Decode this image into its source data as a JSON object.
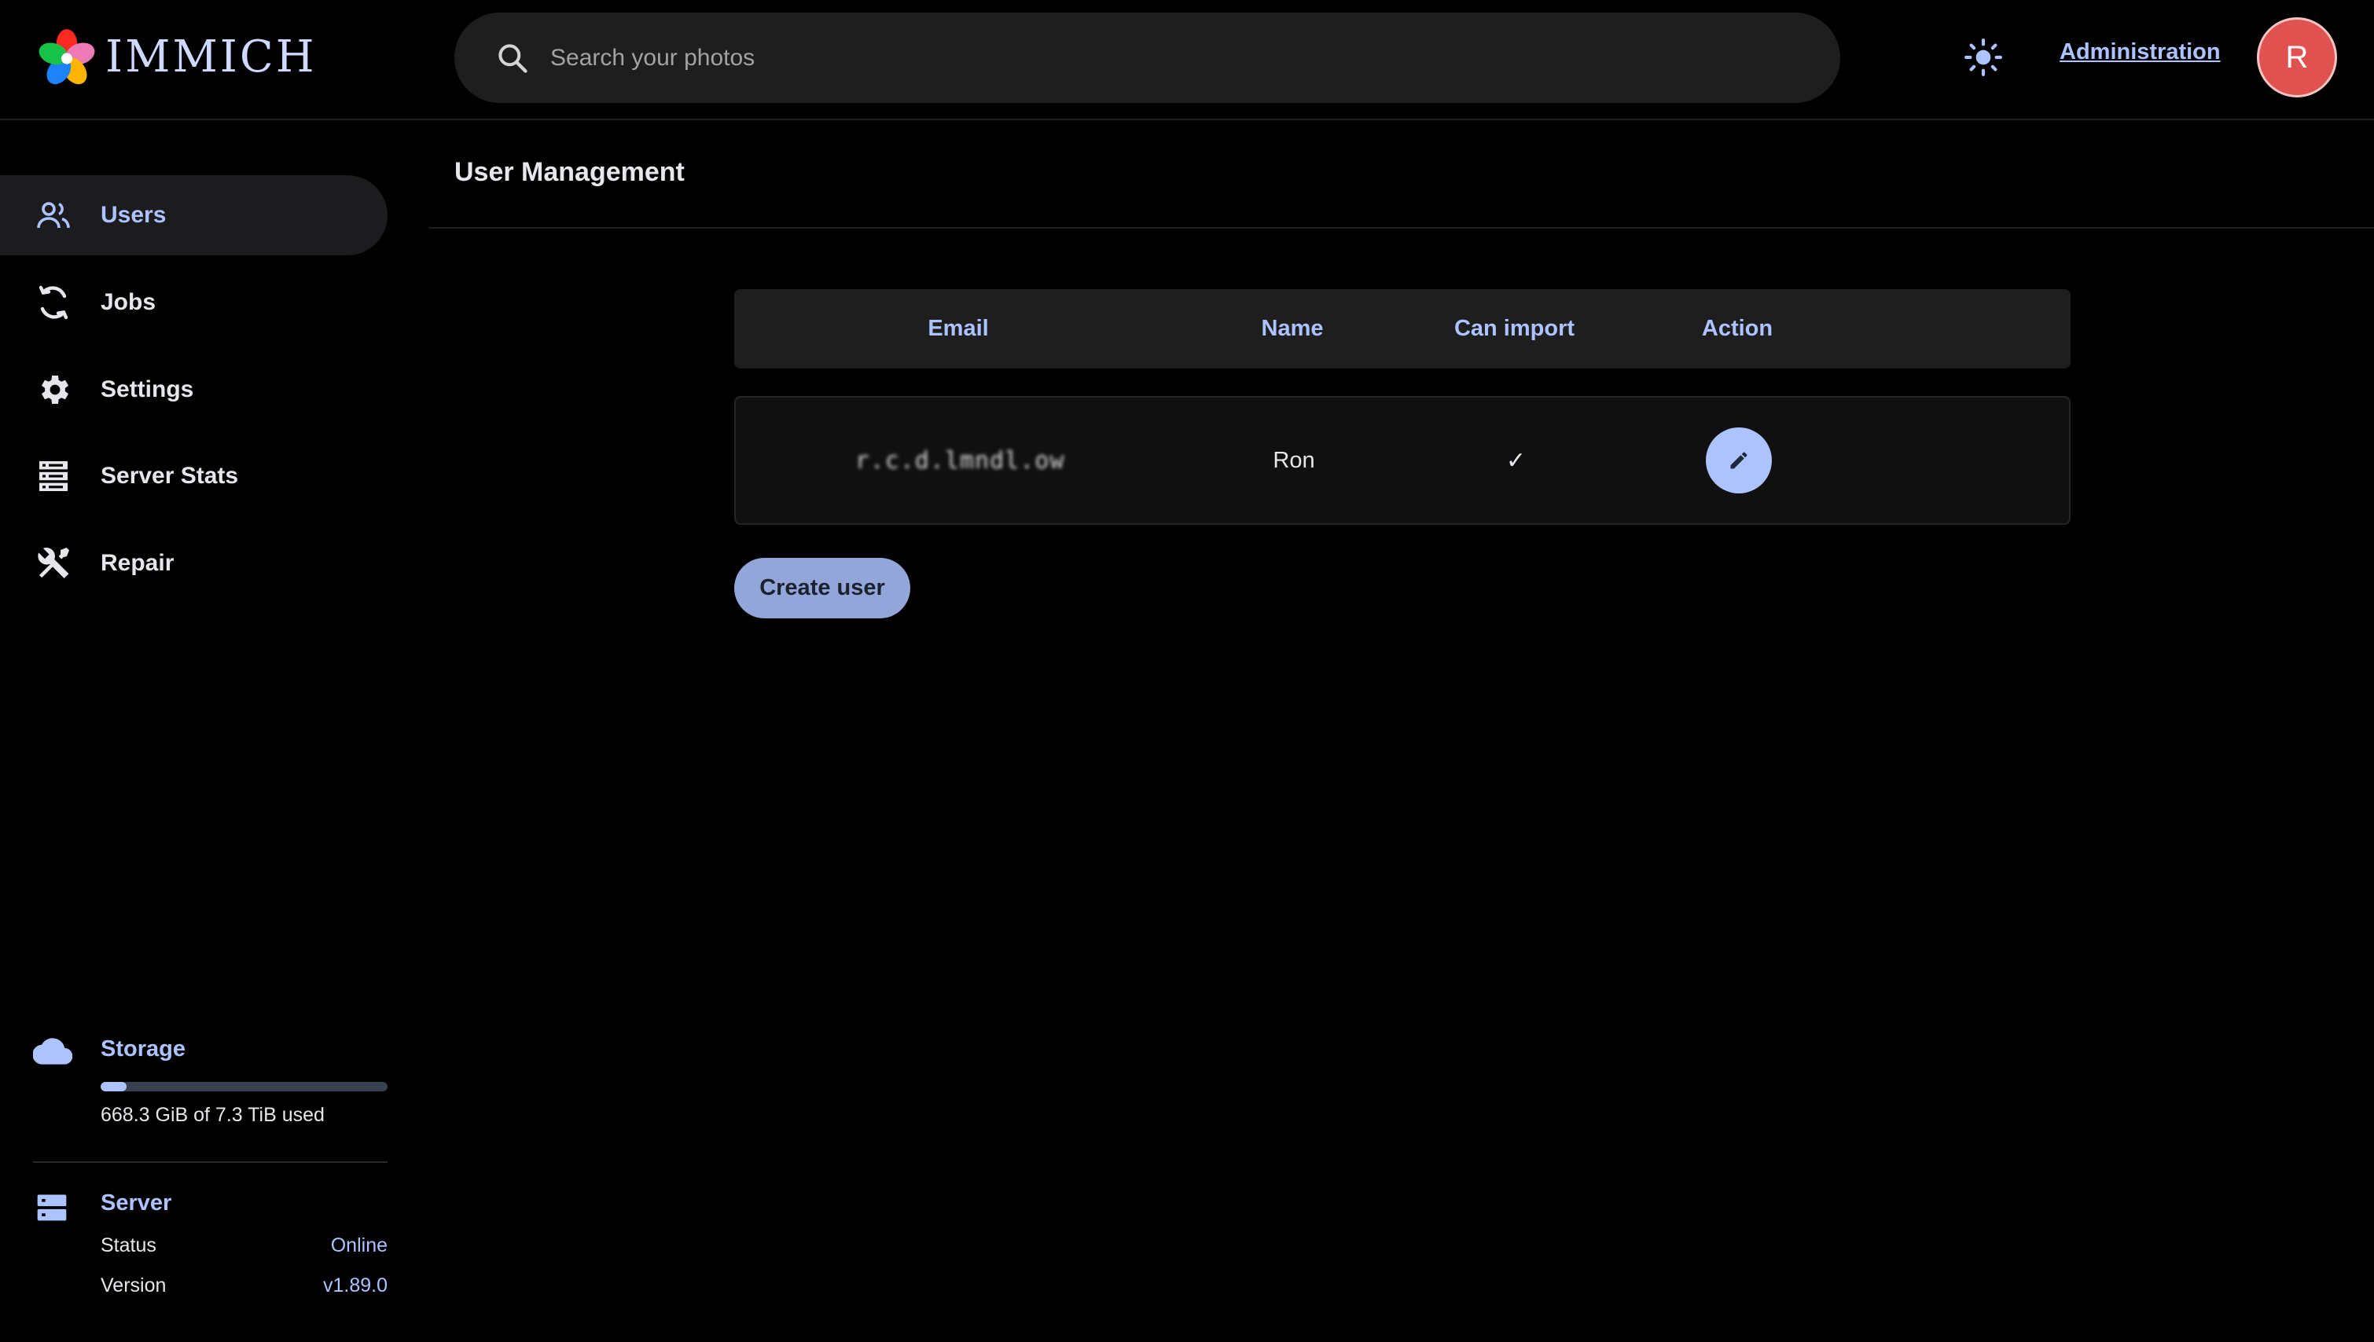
{
  "header": {
    "app_name": "IMMICH",
    "search_placeholder": "Search your photos",
    "admin_link": "Administration",
    "avatar_initial": "R"
  },
  "sidebar": {
    "items": [
      {
        "label": "Users",
        "icon": "users-icon",
        "active": true
      },
      {
        "label": "Jobs",
        "icon": "sync-icon",
        "active": false
      },
      {
        "label": "Settings",
        "icon": "gear-icon",
        "active": false
      },
      {
        "label": "Server Stats",
        "icon": "server-stats-icon",
        "active": false
      },
      {
        "label": "Repair",
        "icon": "tools-icon",
        "active": false
      }
    ],
    "storage": {
      "title": "Storage",
      "usage_text": "668.3 GiB of 7.3 TiB used",
      "used_fraction": 0.09
    },
    "server": {
      "title": "Server",
      "status_label": "Status",
      "status_value": "Online",
      "version_label": "Version",
      "version_value": "v1.89.0"
    }
  },
  "main": {
    "title": "User Management",
    "table": {
      "headers": [
        "Email",
        "Name",
        "Can import",
        "Action"
      ],
      "rows": [
        {
          "email": "r.c.d.lmndl.ow",
          "name": "Ron",
          "can_import": "✓"
        }
      ]
    },
    "create_button": "Create user"
  },
  "colors": {
    "accent": "#adc3ff",
    "avatar": "#e0524f",
    "background": "#000000",
    "surface": "#1e1e1e"
  }
}
